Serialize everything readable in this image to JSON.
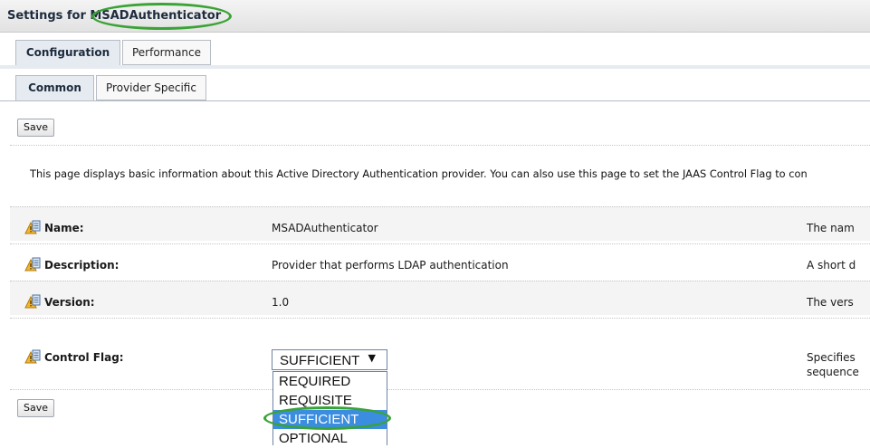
{
  "header": {
    "title": "Settings for MSADAuthenticator"
  },
  "tabs": {
    "outer": [
      {
        "label": "Configuration",
        "active": true
      },
      {
        "label": "Performance",
        "active": false
      }
    ],
    "inner": [
      {
        "label": "Common",
        "active": true
      },
      {
        "label": "Provider Specific",
        "active": false
      }
    ]
  },
  "toolbar": {
    "save_label": "Save"
  },
  "intro_text": "This page displays basic information about this Active Directory Authentication provider. You can also use this page to set the JAAS Control Flag to con",
  "fields": [
    {
      "label": "Name:",
      "value": "MSADAuthenticator",
      "help": "The nam"
    },
    {
      "label": "Description:",
      "value": "Provider that performs LDAP authentication",
      "help": "A short d"
    },
    {
      "label": "Version:",
      "value": "1.0",
      "help": "The vers"
    },
    {
      "label": "Control Flag:",
      "value": "SUFFICIENT",
      "help": "Specifies",
      "help2": "sequence"
    }
  ],
  "control_flag": {
    "selected": "SUFFICIENT",
    "arrow": "▼",
    "options": [
      "REQUIRED",
      "REQUISITE",
      "SUFFICIENT",
      "OPTIONAL"
    ]
  },
  "icons": {
    "field": "lock-info-icon"
  },
  "colors": {
    "highlight": "#3aa335",
    "selection": "#3b8de0"
  }
}
